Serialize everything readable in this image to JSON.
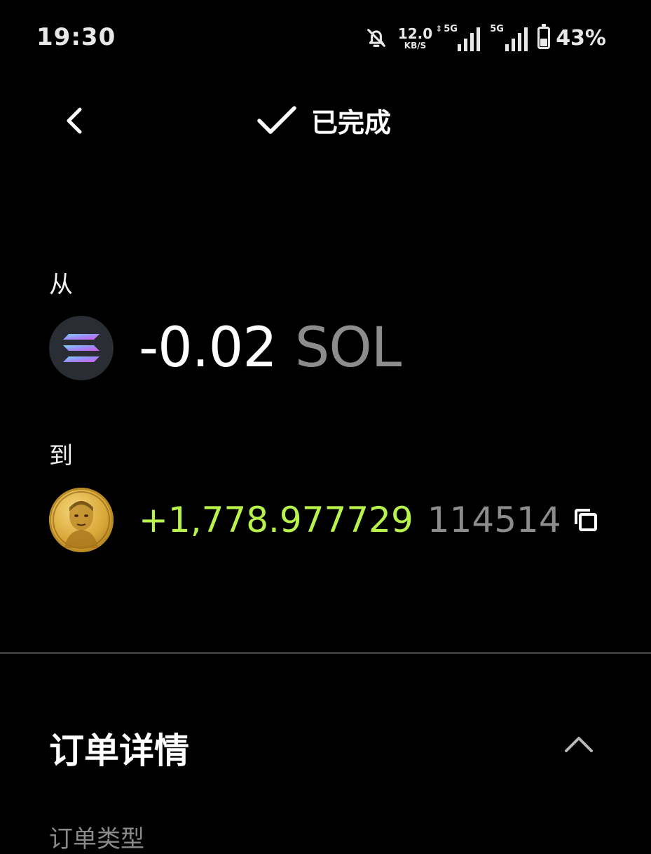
{
  "status_bar": {
    "time": "19:30",
    "mute_icon": "bell-off-icon",
    "network_speed_value": "12.0",
    "network_speed_unit": "KB/S",
    "sim1_label": "5G",
    "sim2_label": "5G",
    "battery_percent": "43%",
    "battery_level": 0.43
  },
  "header": {
    "back_icon": "chevron-left-icon",
    "status_icon": "checkmark-icon",
    "title": "已完成"
  },
  "from": {
    "label": "从",
    "token_icon": "solana-logo-icon",
    "amount": "-0.02",
    "symbol": "SOL"
  },
  "to": {
    "label": "到",
    "token_icon": "gold-coin-portrait-icon",
    "amount": "+1,778.977729",
    "symbol": "114514",
    "copy_icon": "copy-icon",
    "amount_color": "#b7f34a"
  },
  "order_details": {
    "title": "订单详情",
    "collapse_icon": "chevron-up-icon",
    "first_row_label": "订单类型"
  },
  "colors": {
    "background": "#000000",
    "accent_green": "#b7f34a",
    "muted_text": "#8c8c8c"
  }
}
